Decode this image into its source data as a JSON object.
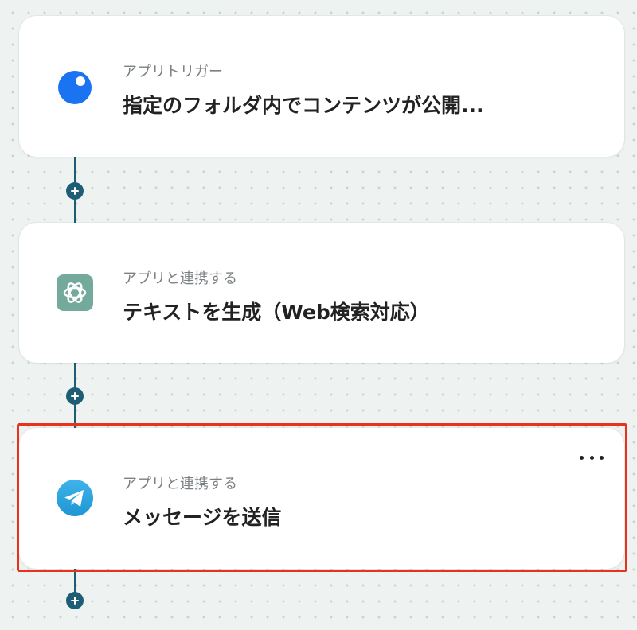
{
  "flow": {
    "steps": [
      {
        "label": "アプリトリガー",
        "title": "指定のフォルダ内でコンテンツが公開...",
        "icon": "app-circle-icon"
      },
      {
        "label": "アプリと連携する",
        "title": "テキストを生成（Web検索対応）",
        "icon": "openai-icon"
      },
      {
        "label": "アプリと連携する",
        "title": "メッセージを送信",
        "icon": "telegram-icon"
      }
    ],
    "selected_step": 3,
    "add_button_label": "+"
  },
  "colors": {
    "connector": "#1d5e74",
    "selection_border": "#e8321d",
    "trigger_icon": "#1a73f0",
    "openai_icon_bg": "#74aa9c",
    "telegram_icon": "#2aa3e0"
  }
}
